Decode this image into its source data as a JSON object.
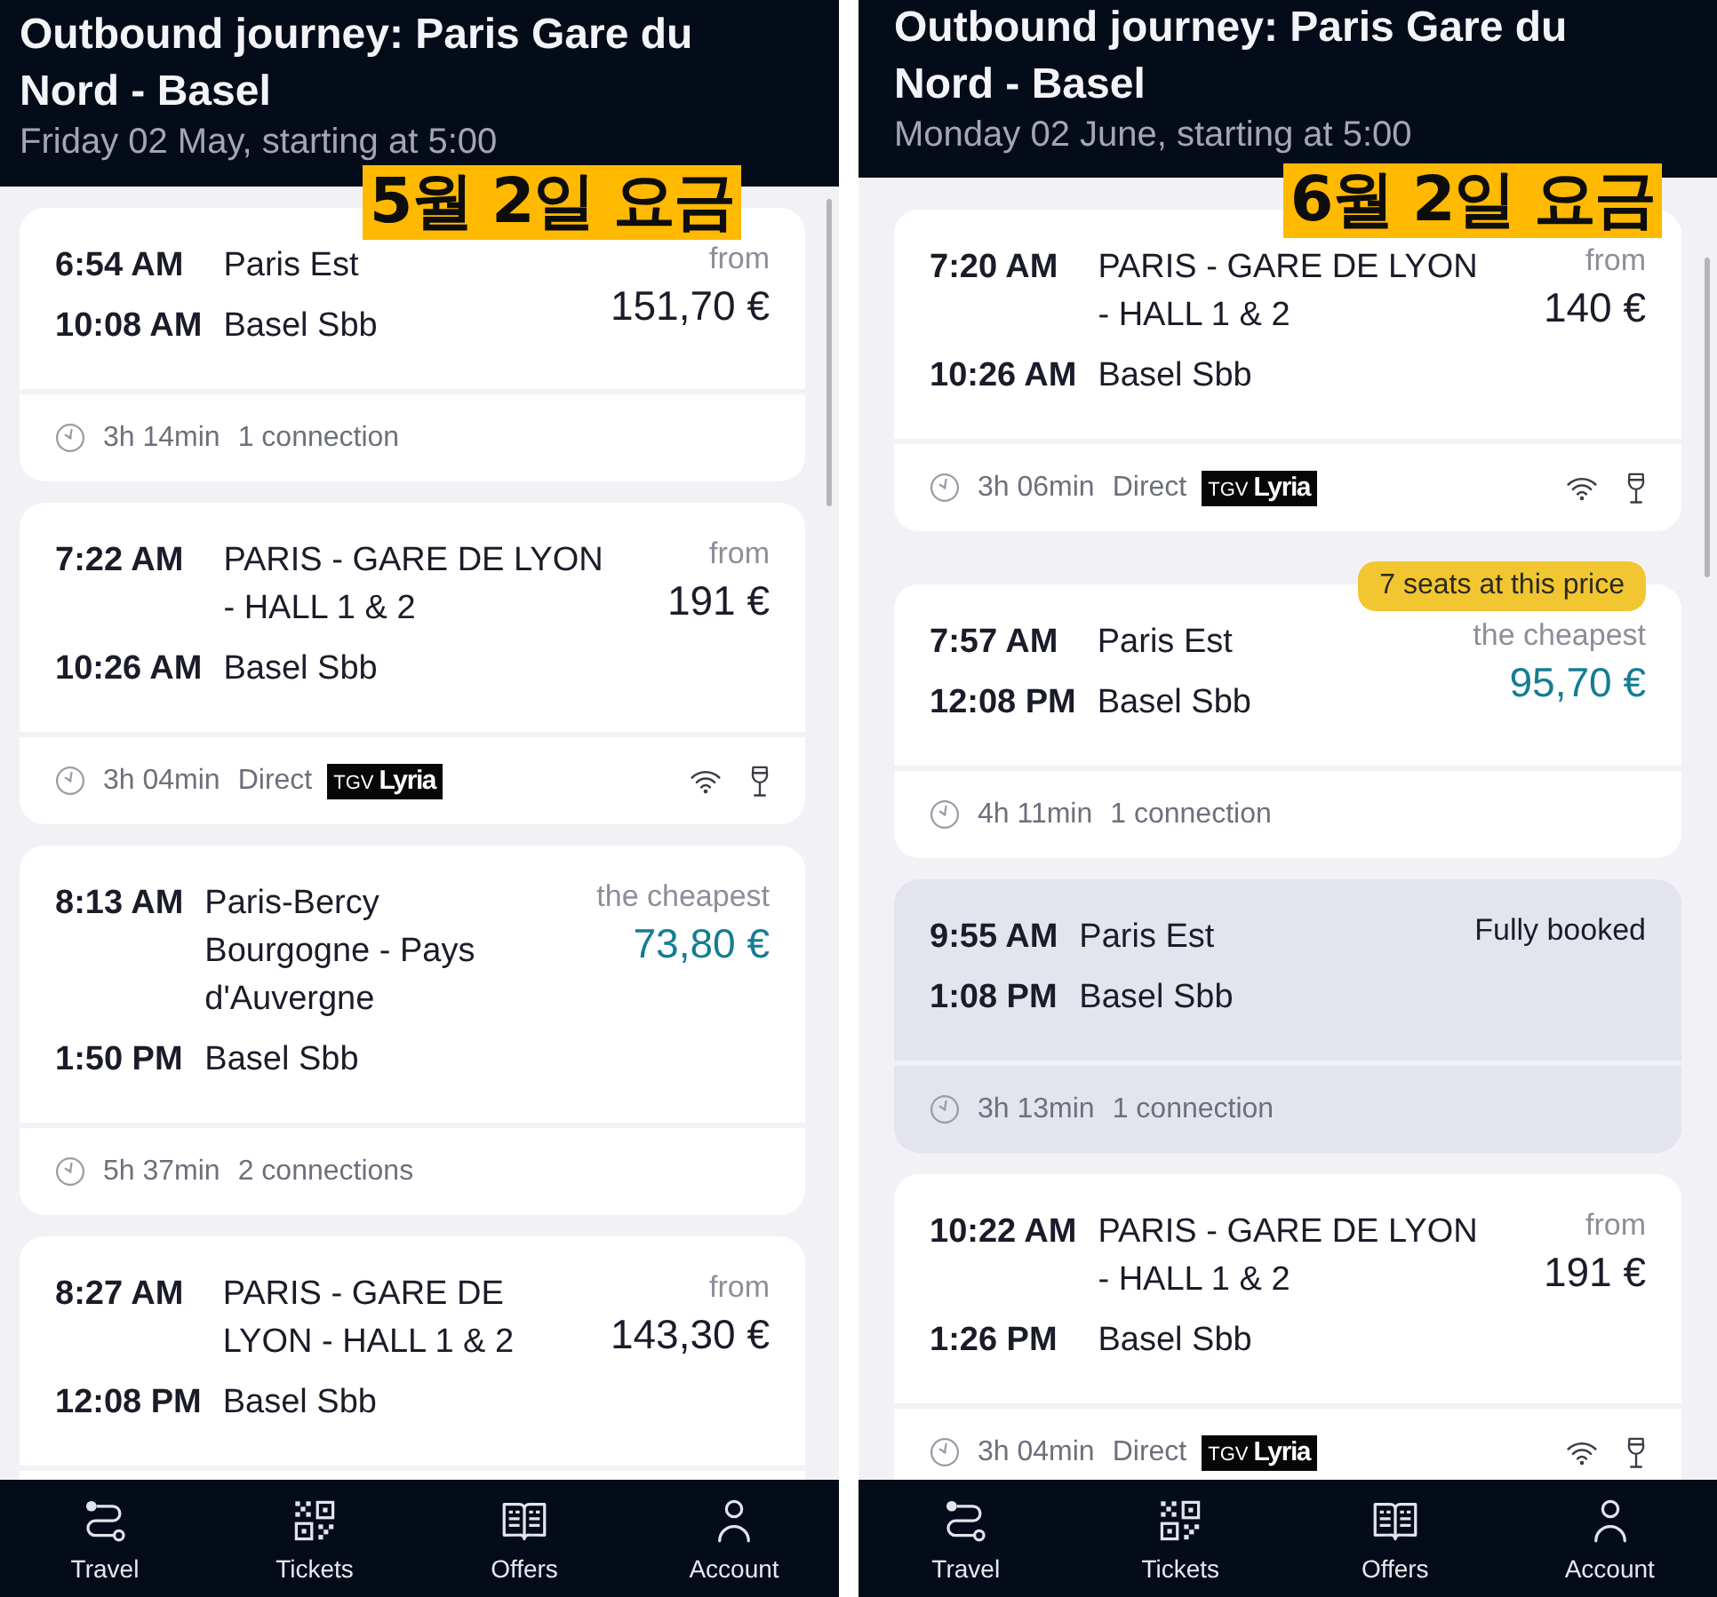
{
  "panels": [
    {
      "header": {
        "title": "Outbound journey: Paris Gare du Nord - Basel",
        "subtitle": "Friday 02 May, starting at 5:00"
      },
      "annotation": "5월 2일 요금",
      "journeys": [
        {
          "departure_time": "6:54 AM",
          "departure_station": "Paris Est",
          "arrival_time": "10:08 AM",
          "arrival_station": "Basel Sbb",
          "price_label": "from",
          "price": "151,70 €",
          "cheapest": false,
          "booked": false,
          "duration": "3h 14min",
          "connections": "1 connection"
        },
        {
          "departure_time": "7:22 AM",
          "departure_station": "PARIS - GARE DE LYON - HALL 1 & 2",
          "arrival_time": "10:26 AM",
          "arrival_station": "Basel Sbb",
          "price_label": "from",
          "price": "191 €",
          "cheapest": false,
          "booked": false,
          "duration": "3h 04min",
          "connections": "Direct",
          "operator_logo": "TGV **Lyria**",
          "amenities": [
            {
              "kind": "wifi"
            },
            {
              "kind": "bar"
            }
          ]
        },
        {
          "departure_time": "8:13 AM",
          "departure_station": "Paris-Bercy Bourgogne - Pays d'Auvergne",
          "arrival_time": "1:50 PM",
          "arrival_station": "Basel Sbb",
          "price_label": "the cheapest",
          "price": "73,80 €",
          "cheapest": true,
          "booked": false,
          "duration": "5h 37min",
          "connections": "2 connections"
        },
        {
          "departure_time": "8:27 AM",
          "departure_station": "PARIS - GARE DE LYON - HALL 1 & 2",
          "arrival_time": "12:08 PM",
          "arrival_station": "Basel Sbb",
          "price_label": "from",
          "price": "143,30 €",
          "cheapest": false,
          "booked": false
        }
      ],
      "nav": [
        {
          "label": "Travel",
          "kind": "travel"
        },
        {
          "label": "Tickets",
          "kind": "tickets"
        },
        {
          "label": "Offers",
          "kind": "offers"
        },
        {
          "label": "Account",
          "kind": "account"
        }
      ]
    },
    {
      "header": {
        "title": "Outbound journey: Paris Gare du Nord - Basel",
        "subtitle": "Monday 02 June, starting at 5:00"
      },
      "annotation": "6월 2일 요금",
      "journeys": [
        {
          "departure_time": "7:20 AM",
          "departure_station": "PARIS - GARE DE LYON - HALL 1 & 2",
          "arrival_time": "10:26 AM",
          "arrival_station": "Basel Sbb",
          "price_label": "from",
          "price": "140 €",
          "cheapest": false,
          "booked": false,
          "duration": "3h 06min",
          "connections": "Direct",
          "operator_logo": "TGV **Lyria**",
          "amenities": [
            {
              "kind": "wifi"
            },
            {
              "kind": "bar"
            }
          ]
        },
        {
          "badge": "7 seats at this price",
          "departure_time": "7:57 AM",
          "departure_station": "Paris Est",
          "arrival_time": "12:08 PM",
          "arrival_station": "Basel Sbb",
          "price_label": "the cheapest",
          "price": "95,70 €",
          "cheapest": true,
          "booked": false,
          "duration": "4h 11min",
          "connections": "1 connection"
        },
        {
          "departure_time": "9:55 AM",
          "departure_station": "Paris Est",
          "arrival_time": "1:08 PM",
          "arrival_station": "Basel Sbb",
          "status": "Fully booked",
          "booked": true,
          "duration": "3h 13min",
          "connections": "1 connection"
        },
        {
          "departure_time": "10:22 AM",
          "departure_station": "PARIS - GARE DE LYON - HALL 1 & 2",
          "arrival_time": "1:26 PM",
          "arrival_station": "Basel Sbb",
          "price_label": "from",
          "price": "191 €",
          "cheapest": false,
          "booked": false,
          "duration": "3h 04min",
          "connections": "Direct",
          "operator_logo": "TGV **Lyria**",
          "amenities": [
            {
              "kind": "wifi"
            },
            {
              "kind": "bar"
            }
          ]
        }
      ],
      "nav": [
        {
          "label": "Travel",
          "kind": "travel"
        },
        {
          "label": "Tickets",
          "kind": "tickets"
        },
        {
          "label": "Offers",
          "kind": "offers"
        },
        {
          "label": "Account",
          "kind": "account"
        }
      ]
    }
  ]
}
